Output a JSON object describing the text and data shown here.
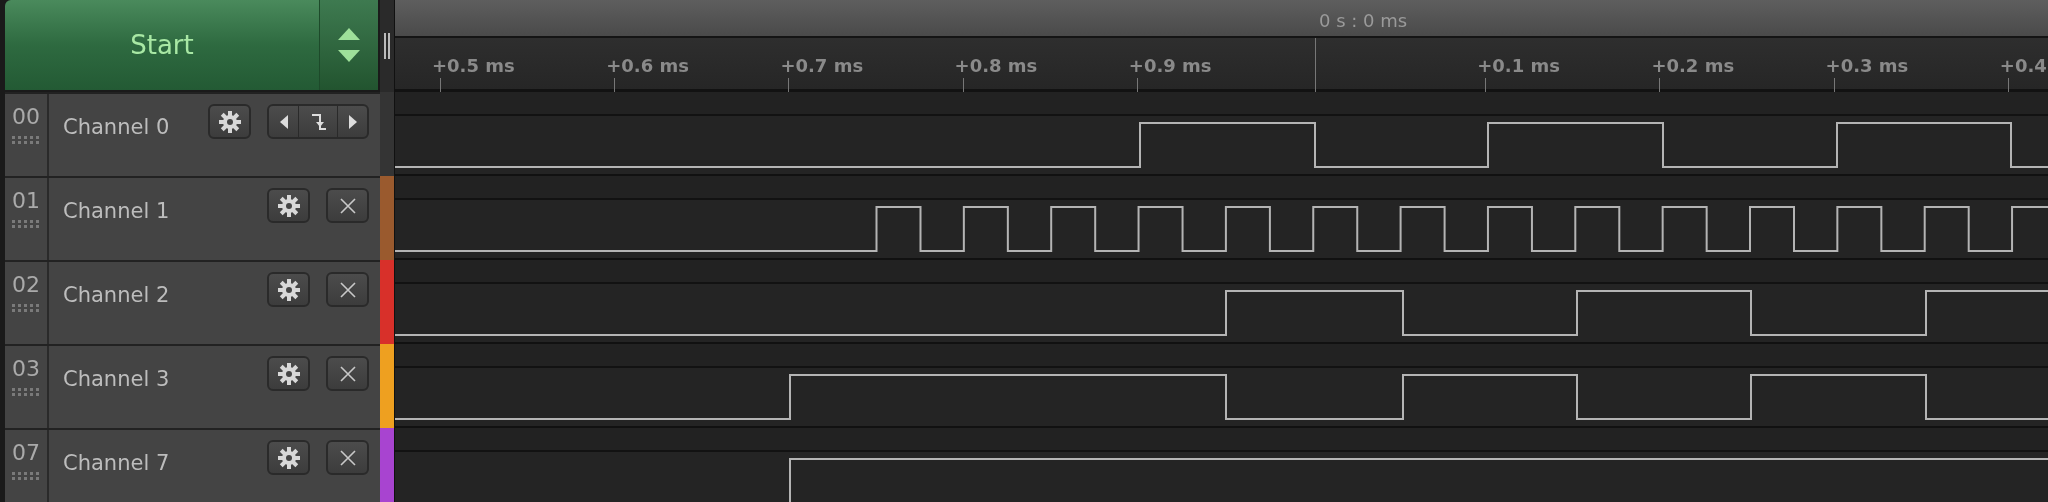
{
  "start_button": {
    "label": "Start"
  },
  "time_cursor": {
    "label": "0 s : 0 ms"
  },
  "ruler": {
    "ticks": [
      "+0.5 ms",
      "+0.6 ms",
      "+0.7 ms",
      "+0.8 ms",
      "+0.9 ms",
      "+0.1 ms",
      "+0.2 ms",
      "+0.3 ms",
      "+0.4"
    ]
  },
  "channels": [
    {
      "number": "00",
      "name": "Channel 0",
      "color": "#343434",
      "kind": "trigger"
    },
    {
      "number": "01",
      "name": "Channel 1",
      "color": "#9a5a2e",
      "kind": "removable"
    },
    {
      "number": "02",
      "name": "Channel 2",
      "color": "#d8302a",
      "kind": "removable"
    },
    {
      "number": "03",
      "name": "Channel 3",
      "color": "#eea020",
      "kind": "removable"
    },
    {
      "number": "07",
      "name": "Channel 7",
      "color": "#a844d0",
      "kind": "removable"
    }
  ]
}
